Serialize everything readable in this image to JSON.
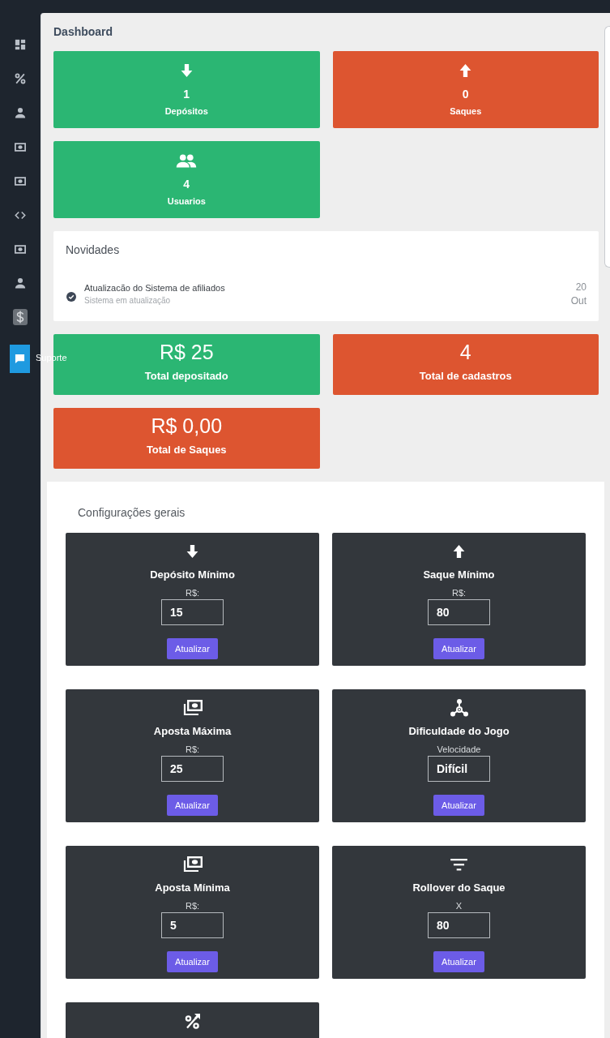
{
  "sidebar": {
    "support_button": {
      "label": "Suporte"
    }
  },
  "page_title": "Dashboard",
  "stat_cards": [
    {
      "value": "1",
      "label": "Depósitos",
      "color": "#2bb673"
    },
    {
      "value": "0",
      "label": "Saques",
      "color": "#dd5530"
    },
    {
      "value": "4",
      "label": "Usuarios",
      "color": "#2bb673"
    }
  ],
  "news": {
    "title": "Novidades",
    "items": [
      {
        "title": "Atualizacão do Sistema de afiliados",
        "subtitle": "Sistema em atualização",
        "day": "20",
        "month": "Out"
      }
    ]
  },
  "total_cards": [
    {
      "value": "R$ 25",
      "label": "Total depositado",
      "color": "#2bb673"
    },
    {
      "value": "4",
      "label": "Total de cadastros",
      "color": "#dd5530"
    },
    {
      "value": "R$ 0,00",
      "label": "Total de Saques",
      "color": "#dd5530"
    }
  ],
  "settings": {
    "title": "Configurações gerais",
    "cards": [
      {
        "kind": "form",
        "title": "Depósito Mínimo",
        "field_label": "R$:",
        "value": "15",
        "button": "Atualizar"
      },
      {
        "kind": "form",
        "title": "Saque Mínimo",
        "field_label": "R$:",
        "value": "80",
        "button": "Atualizar"
      },
      {
        "kind": "form",
        "title": "Aposta Máxima",
        "field_label": "R$:",
        "value": "25",
        "button": "Atualizar"
      },
      {
        "kind": "form",
        "title": "Dificuldade do Jogo",
        "field_label": "Velocidade",
        "value": "Difícil",
        "button": "Atualizar"
      },
      {
        "kind": "form",
        "title": "Aposta Mínima",
        "field_label": "R$:",
        "value": "5",
        "button": "Atualizar"
      },
      {
        "kind": "form",
        "title": "Rollover do Saque",
        "field_label": "X",
        "value": "80",
        "button": "Atualizar"
      },
      {
        "kind": "partial"
      }
    ]
  }
}
